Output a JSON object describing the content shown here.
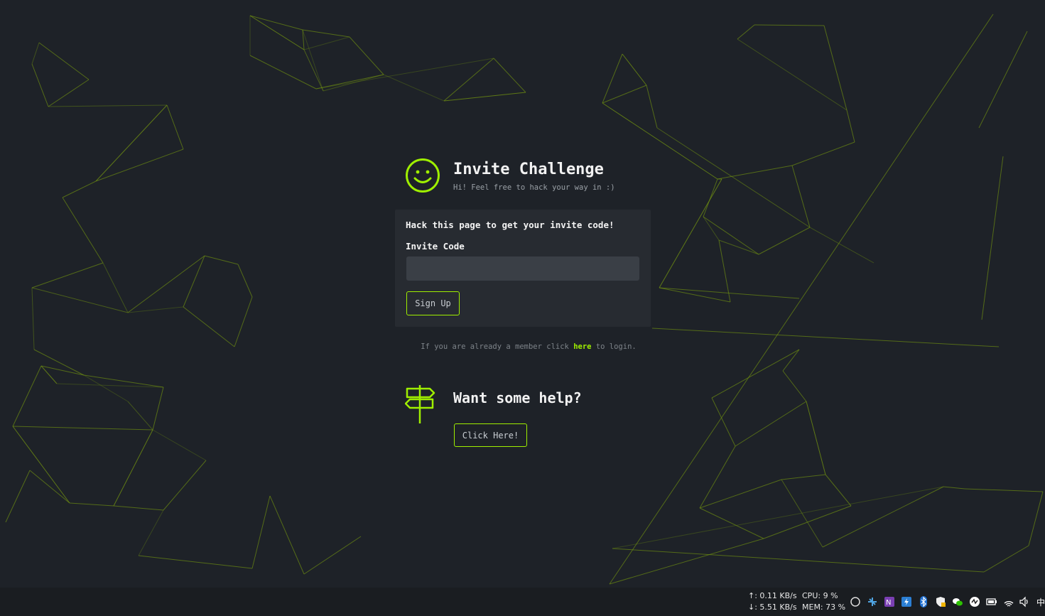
{
  "header": {
    "title": "Invite Challenge",
    "subtitle": "Hi! Feel free to hack your way in :)"
  },
  "panel": {
    "heading": "Hack this page to get your invite code!",
    "field_label": "Invite Code",
    "input_value": "",
    "input_placeholder": "",
    "signup_label": "Sign Up"
  },
  "login_note": {
    "prefix": "If you are already a member click ",
    "link": "here",
    "suffix": " to login."
  },
  "help": {
    "title": "Want some help?",
    "button_label": "Click Here!"
  },
  "taskbar": {
    "net_up": "↑: 0.11 KB/s",
    "net_down": "↓: 5.51 KB/s",
    "cpu": "CPU:  9 %",
    "mem": "MEM: 73 %",
    "tray_icons": [
      "circle-icon",
      "network-tool-icon",
      "onenote-icon",
      "shortcut-icon",
      "bluetooth-icon",
      "security-shield-icon",
      "wechat-icon",
      "media-icon",
      "battery-icon",
      "wifi-icon",
      "volume-icon"
    ],
    "ime_label": "中"
  },
  "colors": {
    "background": "#1e2228",
    "panel": "#272b31",
    "accent": "#9fef00",
    "network_lines": "#6b8a12",
    "taskbar": "#1a1d21"
  }
}
